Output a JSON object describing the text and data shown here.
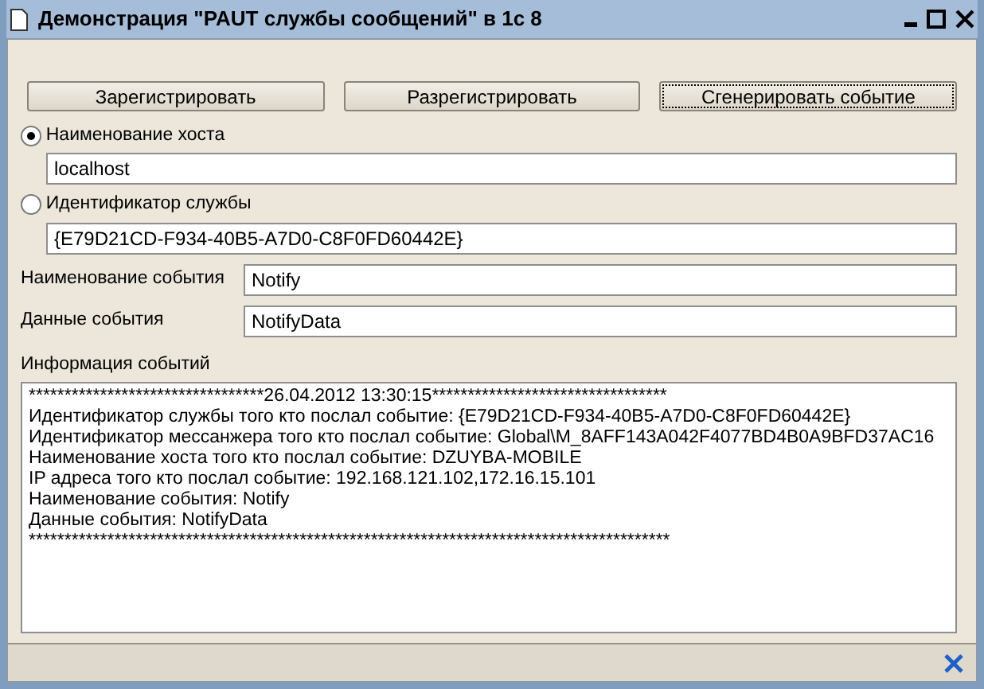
{
  "window": {
    "title": "Демонстрация \"PAUT службы сообщений\" в 1с 8"
  },
  "buttons": [
    {
      "label": "Зарегистрировать",
      "focused": false
    },
    {
      "label": "Разрегистрировать",
      "focused": false
    },
    {
      "label": "Сгенерировать событие",
      "focused": true
    }
  ],
  "address_options": [
    {
      "label": "Наименование хоста",
      "selected": true,
      "value": "localhost"
    },
    {
      "label": "Идентификатор службы",
      "selected": false,
      "value": "{E79D21CD-F934-40B5-A7D0-C8F0FD60442E}"
    }
  ],
  "fields": [
    {
      "label": "Наименование события",
      "value": "Notify"
    },
    {
      "label": "Данные события",
      "value": "NotifyData"
    }
  ],
  "event_log": {
    "label": "Информация событий",
    "lines": [
      "*********************************26.04.2012 13:30:15*********************************",
      "Идентификатор службы того кто послал событие: {E79D21CD-F934-40B5-A7D0-C8F0FD60442E}",
      "Идентификатор мессанжера того кто послал событие: Global\\M_8AFF143A042F4077BD4B0A9BFD37AC16",
      "Наименование хоста того кто послал событие: DZUYBA-MOBILE",
      "IP адреса того кто послал событие: 192.168.121.102,172.16.15.101",
      "Наименование события: Notify",
      "Данные события: NotifyData",
      "******************************************************************************************"
    ]
  }
}
